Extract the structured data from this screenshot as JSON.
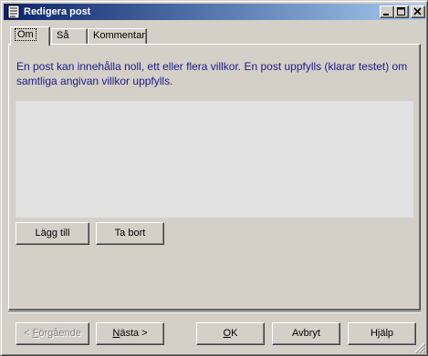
{
  "window": {
    "title": "Redigera post",
    "controls": [
      "minimize-icon",
      "maximize-icon",
      "close-icon"
    ]
  },
  "tabs": [
    {
      "label": "Om",
      "selected": true
    },
    {
      "label": "Så",
      "selected": false
    },
    {
      "label": "Kommentar",
      "selected": false
    }
  ],
  "panel": {
    "description": "En post kan innehålla noll, ett eller flera villkor. En post uppfylls (klarar testet) om samtliga angivan villkor uppfylls.",
    "buttons": {
      "add": "Lägg till",
      "remove": "Ta bort"
    }
  },
  "footer": {
    "prev": {
      "prefix": "< ",
      "mnemonic": "F",
      "rest": "örgående",
      "enabled": false
    },
    "next": {
      "mnemonic": "N",
      "rest": "ästa",
      "suffix": " >"
    },
    "ok": {
      "mnemonic": "O",
      "rest": "K"
    },
    "cancel": "Avbryt",
    "help": "Hjälp"
  },
  "colors": {
    "face": "#d4d0c8",
    "titlebar": "#0a246a",
    "description_text": "#1a1a8c",
    "list_bg": "#e1e1e1"
  }
}
